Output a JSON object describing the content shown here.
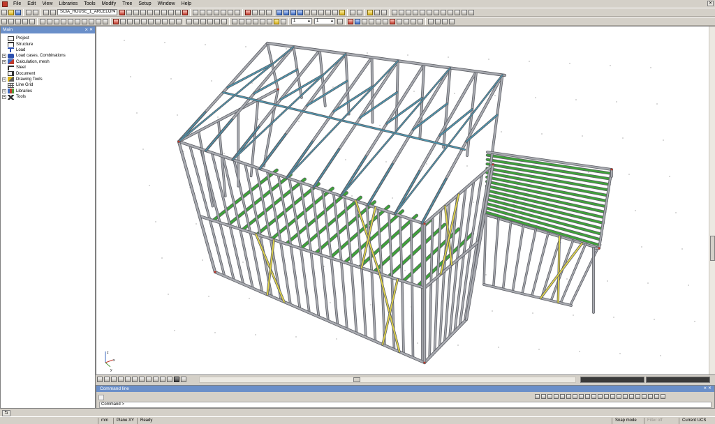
{
  "menu": [
    "File",
    "Edit",
    "View",
    "Libraries",
    "Tools",
    "Modify",
    "Tree",
    "Setup",
    "Window",
    "Help"
  ],
  "toolbar": {
    "project_combo": "SCIA_HOUSE_1_ARCELOF",
    "spin_a": "1",
    "spin_b": "1"
  },
  "main_panel": {
    "title": "Main",
    "buttons": "⨯ ✕",
    "tree": [
      {
        "label": "Project",
        "expandable": false,
        "icon": "project-icon"
      },
      {
        "label": "Structure",
        "expandable": false,
        "icon": "structure-icon"
      },
      {
        "label": "Load",
        "expandable": false,
        "icon": "load-icon"
      },
      {
        "label": "Load cases, Combinations",
        "expandable": true,
        "icon": "load-cases-icon"
      },
      {
        "label": "Calculation, mesh",
        "expandable": true,
        "icon": "calculation-mesh-icon"
      },
      {
        "label": "Steel",
        "expandable": false,
        "icon": "steel-icon"
      },
      {
        "label": "Document",
        "expandable": false,
        "icon": "document-icon"
      },
      {
        "label": "Drawing Tools",
        "expandable": true,
        "icon": "drawing-tools-icon"
      },
      {
        "label": "Line Grid",
        "expandable": false,
        "icon": "line-grid-icon"
      },
      {
        "label": "Libraries",
        "expandable": true,
        "icon": "libraries-icon"
      },
      {
        "label": "Tools",
        "expandable": true,
        "icon": "tools-icon"
      }
    ]
  },
  "axis_labels": {
    "x": "x",
    "y": "y",
    "z": "z"
  },
  "command_panel": {
    "title": "Command line",
    "buttons": "⨯ ✕",
    "prompt": "Command >"
  },
  "status": {
    "units": "mm",
    "plane": "Plane XY",
    "state": "Ready",
    "snap": "Snap mode",
    "filter": "Filter off",
    "ucs": "Current UCS"
  },
  "colors": {
    "frame": "#a8aab0",
    "frame_dark": "#5e6066",
    "joist": "#3fa33a",
    "brace_yellow": "#e3d64a",
    "brace_blue": "#4c98b2",
    "panel_header": "#6a8fc9"
  }
}
